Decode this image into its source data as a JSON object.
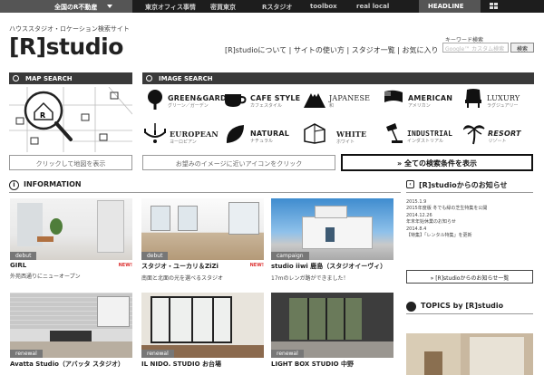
{
  "topbar": {
    "location": "全国のR不動産",
    "nav": [
      "東京オフィス事情",
      "密買東京",
      "Rスタジオ",
      "toolbox",
      "real local"
    ],
    "headline": "HEADLINE"
  },
  "header": {
    "tagline": "ハウススタジオ・ロケーション検索サイト",
    "logo": "[R]studio",
    "links": [
      "[R]studioについて",
      "サイトの使い方",
      "スタジオ一覧",
      "お気に入り"
    ],
    "search_label": "キーワード検索",
    "search_placeholder": "Google™ カスタム検索",
    "search_button": "検索"
  },
  "map_search": {
    "title": "MAP SEARCH",
    "button": "クリックして地図を表示"
  },
  "image_search": {
    "title": "IMAGE SEARCH",
    "categories": [
      {
        "en": "GREEN&GARDEN",
        "jp": "グリーン／ガーデン"
      },
      {
        "en": "CAFE STYLE",
        "jp": "カフェスタイル"
      },
      {
        "en": "JAPANESE",
        "jp": "和"
      },
      {
        "en": "AMERICAN",
        "jp": "アメリカン"
      },
      {
        "en": "LUXURY",
        "jp": "ラグジュアリー"
      },
      {
        "en": "EUROPEAN",
        "jp": "ヨーロピアン"
      },
      {
        "en": "NATURAL",
        "jp": "ナチュラル"
      },
      {
        "en": "WHITE",
        "jp": "ホワイト"
      },
      {
        "en": "INDUSTRIAL",
        "jp": "インダストリアル"
      },
      {
        "en": "RESORT",
        "jp": "リゾート"
      }
    ],
    "button": "お望みのイメージに近いアイコンをクリック",
    "all_button": "全ての検索条件を表示"
  },
  "information": {
    "title": "INFORMATION",
    "cards": [
      {
        "badge": "debut",
        "title": "GIRL",
        "sub": "外苑西通りにニューオープン",
        "new": "NEW!"
      },
      {
        "badge": "debut",
        "title": "スタジオ・ユーカリ＆ZiZi",
        "sub": "南面と北面の光を選べるスタジオ",
        "new": "NEW!"
      },
      {
        "badge": "campaign",
        "title": "studio iiwi 鹿島（スタジオイーヴィ）",
        "sub": "17mのレンガ路ができました！",
        "new": ""
      },
      {
        "badge": "renewal",
        "title": "Avatta Studio（アバッタ スタジオ）",
        "sub": "",
        "new": ""
      },
      {
        "badge": "renewal",
        "title": "IL NIDO. STUDIO お台場",
        "sub": "",
        "new": ""
      },
      {
        "badge": "renewal",
        "title": "LIGHT BOX STUDIO 中野",
        "sub": "",
        "new": ""
      }
    ]
  },
  "news": {
    "title": "[R]studioからのお知らせ",
    "items": [
      {
        "date": "2015.1.9",
        "text": "2015年度版 冬でも緑の芝生特集を公開"
      },
      {
        "date": "2014.12.26",
        "text": "年末年始休業のお知らせ"
      },
      {
        "date": "2014.8.4",
        "text": "【特集】「レンタル特集」を更新"
      }
    ],
    "more": "[R]studioからのお知らせ一覧"
  },
  "topics": {
    "title": "TOPICS by [R]studio"
  }
}
